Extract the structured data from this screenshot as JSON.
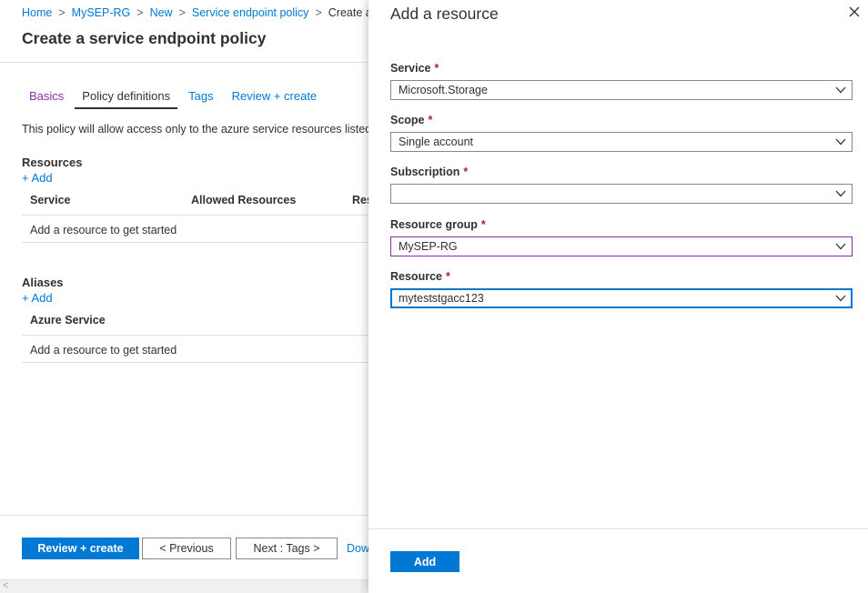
{
  "breadcrumb": {
    "items": [
      "Home",
      "MySEP-RG",
      "New",
      "Service endpoint policy"
    ],
    "current": "Create a se"
  },
  "page": {
    "title": "Create a service endpoint policy",
    "tabs": [
      {
        "label": "Basics",
        "state": "visited"
      },
      {
        "label": "Policy definitions",
        "state": "active"
      },
      {
        "label": "Tags",
        "state": "link"
      },
      {
        "label": "Review + create",
        "state": "link"
      }
    ],
    "description": "This policy will allow access only to the azure service resources listed o"
  },
  "resources": {
    "title": "Resources",
    "add_label": "+ Add",
    "columns": [
      "Service",
      "Allowed Resources",
      "Res"
    ],
    "empty_text": "Add a resource to get started"
  },
  "aliases": {
    "title": "Aliases",
    "add_label": "+ Add",
    "columns": [
      "Azure Service"
    ],
    "empty_text": "Add a resource to get started"
  },
  "footer": {
    "review_create": "Review + create",
    "previous": "< Previous",
    "next": "Next : Tags >",
    "download": "Dow"
  },
  "panel": {
    "title": "Add a resource",
    "close_icon": "close-icon",
    "required_mark": "*",
    "fields": [
      {
        "label": "Service",
        "value": "Microsoft.Storage"
      },
      {
        "label": "Scope",
        "value": "Single account"
      },
      {
        "label": "Subscription",
        "value": ""
      },
      {
        "label": "Resource group",
        "value": "MySEP-RG"
      },
      {
        "label": "Resource",
        "value": "myteststgacc123"
      }
    ],
    "add_button": "Add"
  },
  "colors": {
    "accent": "#0078d4",
    "visited": "#8a2ea5",
    "required": "#a4262c",
    "text": "#323130"
  }
}
